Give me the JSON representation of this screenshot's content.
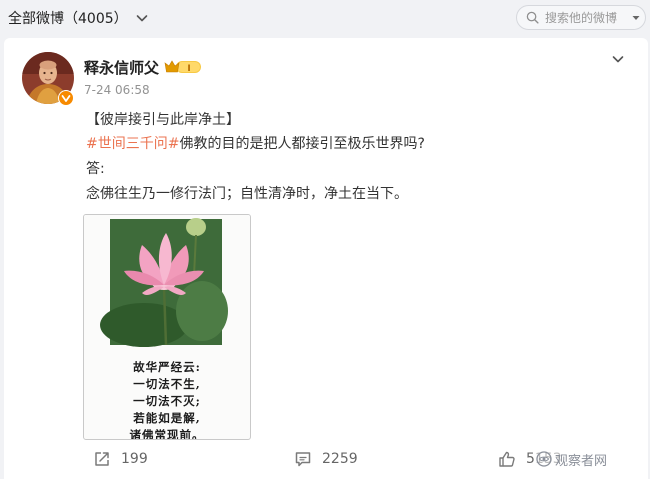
{
  "header": {
    "filter_label": "全部微博（4005）",
    "search_placeholder": "搜索他的微博"
  },
  "post": {
    "author": "释永信师父",
    "vip_level": "I",
    "timestamp": "7-24 06:58",
    "title_line": "【彼岸接引与此岸净土】",
    "hashtag": "#世间三千问#",
    "question": "佛教的目的是把人都接引至极乐世界吗?",
    "answer_label": "答:",
    "answer": "念佛往生乃一修行法门；自性清净时，净土在当下。",
    "image_poem": [
      "故华严经云:",
      "一切法不生,",
      "一切法不灭;",
      "若能如是解,",
      "诸佛常现前。"
    ],
    "actions": {
      "reposts": "199",
      "comments": "2259",
      "likes": "5153"
    }
  },
  "watermark": "观察者网",
  "colors": {
    "hashtag": "#eb7350",
    "vip_gold": "#f5b400",
    "verified": "#f78a00",
    "background": "#f1f2f5"
  }
}
